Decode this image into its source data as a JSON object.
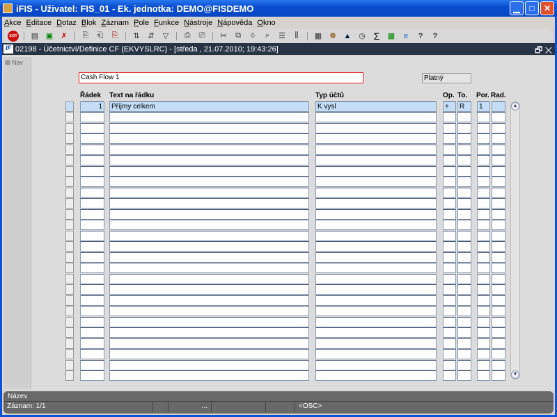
{
  "window": {
    "title": "iFIS - Uživatel: FIS_01 - Ek. jednotka: DEMO@FISDEMO",
    "min": "▁",
    "max": "□",
    "close": "✕"
  },
  "menu": [
    "Akce",
    "Editace",
    "Dotaz",
    "Blok",
    "Záznam",
    "Pole",
    "Funkce",
    "Nástroje",
    "Nápověda",
    "Okno"
  ],
  "toolbar": {
    "exit": "EXIT"
  },
  "form": {
    "title": "02198 - Účetnictví/Definice CF (EKVYSLRC) - [středa , 21.07.2010; 19:43:26]",
    "icon": "IF",
    "restore": "🗗",
    "close": "✕"
  },
  "nav": {
    "label": "Nav"
  },
  "header": {
    "name": "Cash Flow 1",
    "status": "Platný"
  },
  "columns": {
    "radek": "Řádek",
    "text": "Text na řádku",
    "typ": "Typ účtů",
    "op": "Op.",
    "to": "To.",
    "por": "Por.",
    "rad": "Rad."
  },
  "rows": [
    {
      "radek": "1",
      "text": "Příjmy celkem",
      "typ": "K vysl",
      "op": "+",
      "to": "R",
      "por": "1",
      "rad": ""
    }
  ],
  "row_count": 26,
  "statusbar": {
    "hint": "Název",
    "record": "Záznam: 1/1",
    "dots": "...",
    "mode": "<OSC>"
  }
}
